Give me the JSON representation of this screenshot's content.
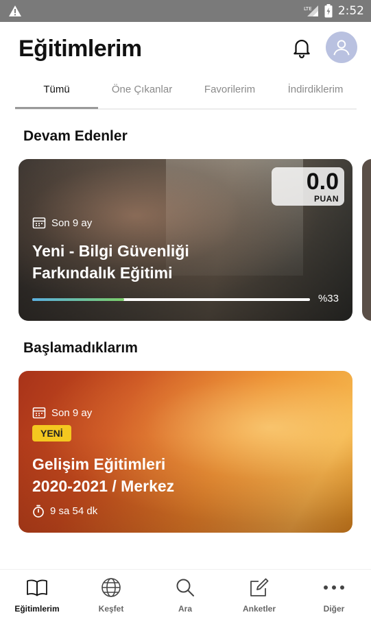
{
  "status_bar": {
    "time": "2:52",
    "icons": [
      "warning-icon",
      "signal-lte-icon",
      "battery-icon"
    ]
  },
  "header": {
    "title": "Eğitimlerim",
    "icons": [
      "bell-icon",
      "avatar"
    ]
  },
  "tabs": [
    {
      "label": "Tümü",
      "active": true
    },
    {
      "label": "Öne Çıkanlar",
      "active": false
    },
    {
      "label": "Favorilerim",
      "active": false
    },
    {
      "label": "İndirdiklerim",
      "active": false
    }
  ],
  "sections": {
    "in_progress": {
      "title": "Devam Edenler",
      "card": {
        "period": "Son 9 ay",
        "score_value": "0.0",
        "score_label": "PUAN",
        "title_line1": "Yeni - Bilgi Güvenliği",
        "title_line2": "Farkındalık Eğitimi",
        "progress_text": "%33",
        "progress_fraction": 0.33
      }
    },
    "not_started": {
      "title": "Başlamadıklarım",
      "card": {
        "period": "Son 9 ay",
        "badge": "YENİ",
        "title_line1": "Gelişim Eğitimleri",
        "title_line2": "2020-2021 / Merkez",
        "duration": "9 sa 54 dk"
      }
    }
  },
  "bottom_nav": [
    {
      "label": "Eğitimlerim",
      "icon": "book-icon",
      "active": true
    },
    {
      "label": "Keşfet",
      "icon": "globe-icon",
      "active": false
    },
    {
      "label": "Ara",
      "icon": "search-icon",
      "active": false
    },
    {
      "label": "Anketler",
      "icon": "edit-icon",
      "active": false
    },
    {
      "label": "Diğer",
      "icon": "more-icon",
      "active": false
    }
  ]
}
